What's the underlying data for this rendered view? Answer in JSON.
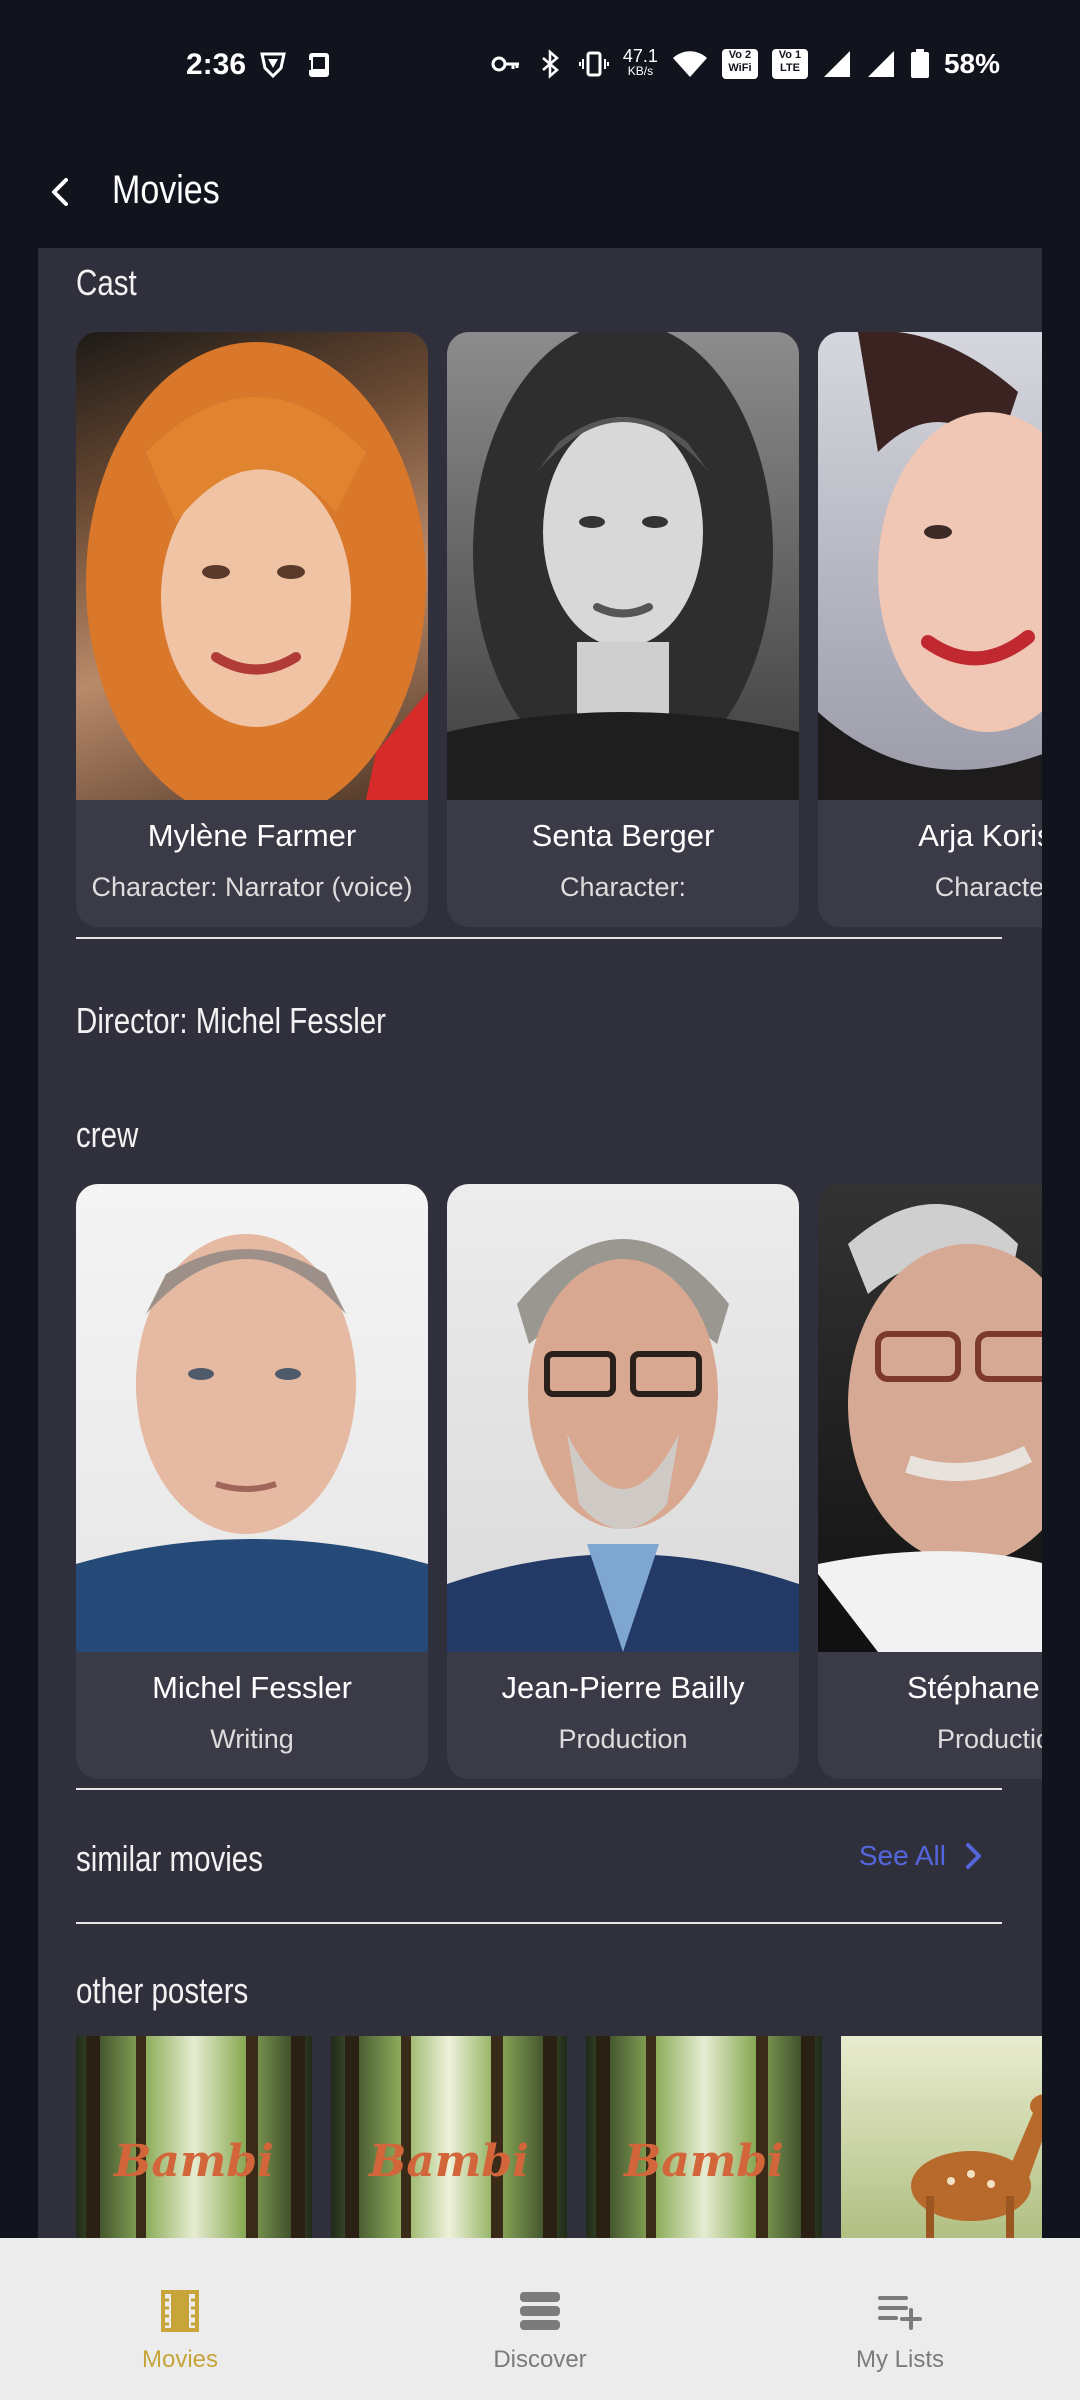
{
  "status": {
    "time": "2:36",
    "net_speed_value": "47.1",
    "net_speed_unit": "KB/s",
    "wifi_badge": "Vo 2 WiFi",
    "lte_badge": "Vo 1 LTE",
    "battery": "58%"
  },
  "header": {
    "title": "Movies"
  },
  "cast": {
    "title": "Cast",
    "items": [
      {
        "name": "Mylène Farmer",
        "role": "Character: Narrator (voice)"
      },
      {
        "name": "Senta Berger",
        "role": "Character:"
      },
      {
        "name": "Arja Korise",
        "role": "Character"
      }
    ]
  },
  "director": {
    "text": "Director: Michel Fessler"
  },
  "crew": {
    "title": "crew",
    "items": [
      {
        "name": "Michel Fessler",
        "role": "Writing"
      },
      {
        "name": "Jean-Pierre Bailly",
        "role": "Production"
      },
      {
        "name": "Stéphane Mi",
        "role": "Productio"
      }
    ]
  },
  "similar": {
    "title": "similar movies",
    "see_all": "See All"
  },
  "posters": {
    "title": "other posters",
    "items": [
      {
        "text": "Bambi"
      },
      {
        "text": "Bambi"
      },
      {
        "text": "Bambi"
      }
    ]
  },
  "nav": {
    "items": [
      {
        "label": "Movies",
        "icon": "film-icon",
        "color": "#c7a53a"
      },
      {
        "label": "Discover",
        "icon": "stack-icon",
        "color": "#7b7b7b"
      },
      {
        "label": "My Lists",
        "icon": "playlist-add-icon",
        "color": "#7b7b7b"
      }
    ]
  }
}
